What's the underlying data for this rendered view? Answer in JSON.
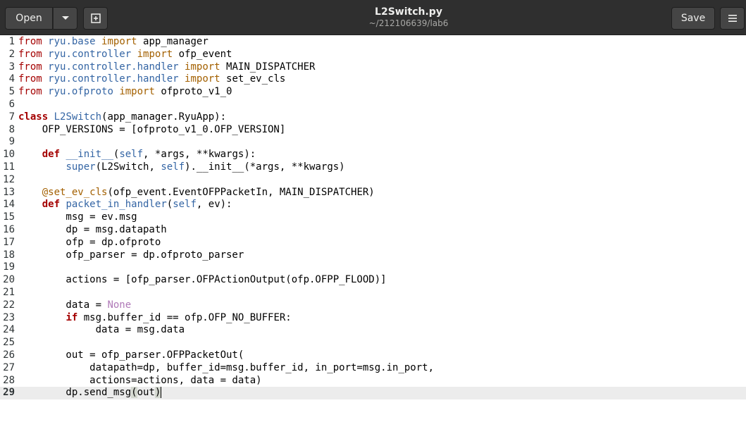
{
  "header": {
    "open_label": "Open",
    "title": "L2Switch.py",
    "subtitle": "~/212106639/lab6",
    "save_label": "Save",
    "icons": {
      "recent": "chevron-down-icon",
      "new_tab": "new-tab-icon",
      "menu": "hamburger-menu-icon"
    }
  },
  "editor": {
    "current_line": 29,
    "lines": [
      {
        "n": "1",
        "t": "from ryu.base import app_manager"
      },
      {
        "n": "2",
        "t": "from ryu.controller import ofp_event"
      },
      {
        "n": "3",
        "t": "from ryu.controller.handler import MAIN_DISPATCHER"
      },
      {
        "n": "4",
        "t": "from ryu.controller.handler import set_ev_cls"
      },
      {
        "n": "5",
        "t": "from ryu.ofproto import ofproto_v1_0"
      },
      {
        "n": "6",
        "t": ""
      },
      {
        "n": "7",
        "t": "class L2Switch(app_manager.RyuApp):"
      },
      {
        "n": "8",
        "t": "    OFP_VERSIONS = [ofproto_v1_0.OFP_VERSION]"
      },
      {
        "n": "9",
        "t": ""
      },
      {
        "n": "10",
        "t": "    def __init__(self, *args, **kwargs):"
      },
      {
        "n": "11",
        "t": "        super(L2Switch, self).__init__(*args, **kwargs)"
      },
      {
        "n": "12",
        "t": ""
      },
      {
        "n": "13",
        "t": "    @set_ev_cls(ofp_event.EventOFPPacketIn, MAIN_DISPATCHER)"
      },
      {
        "n": "14",
        "t": "    def packet_in_handler(self, ev):"
      },
      {
        "n": "15",
        "t": "        msg = ev.msg"
      },
      {
        "n": "16",
        "t": "        dp = msg.datapath"
      },
      {
        "n": "17",
        "t": "        ofp = dp.ofproto"
      },
      {
        "n": "18",
        "t": "        ofp_parser = dp.ofproto_parser"
      },
      {
        "n": "19",
        "t": ""
      },
      {
        "n": "20",
        "t": "        actions = [ofp_parser.OFPActionOutput(ofp.OFPP_FLOOD)]"
      },
      {
        "n": "21",
        "t": ""
      },
      {
        "n": "22",
        "t": "        data = None"
      },
      {
        "n": "23",
        "t": "        if msg.buffer_id == ofp.OFP_NO_BUFFER:"
      },
      {
        "n": "24",
        "t": "             data = msg.data"
      },
      {
        "n": "25",
        "t": ""
      },
      {
        "n": "26",
        "t": "        out = ofp_parser.OFPPacketOut("
      },
      {
        "n": "27",
        "t": "            datapath=dp, buffer_id=msg.buffer_id, in_port=msg.in_port,"
      },
      {
        "n": "28",
        "t": "            actions=actions, data = data)"
      },
      {
        "n": "29",
        "t": "        dp.send_msg(out)"
      }
    ]
  }
}
